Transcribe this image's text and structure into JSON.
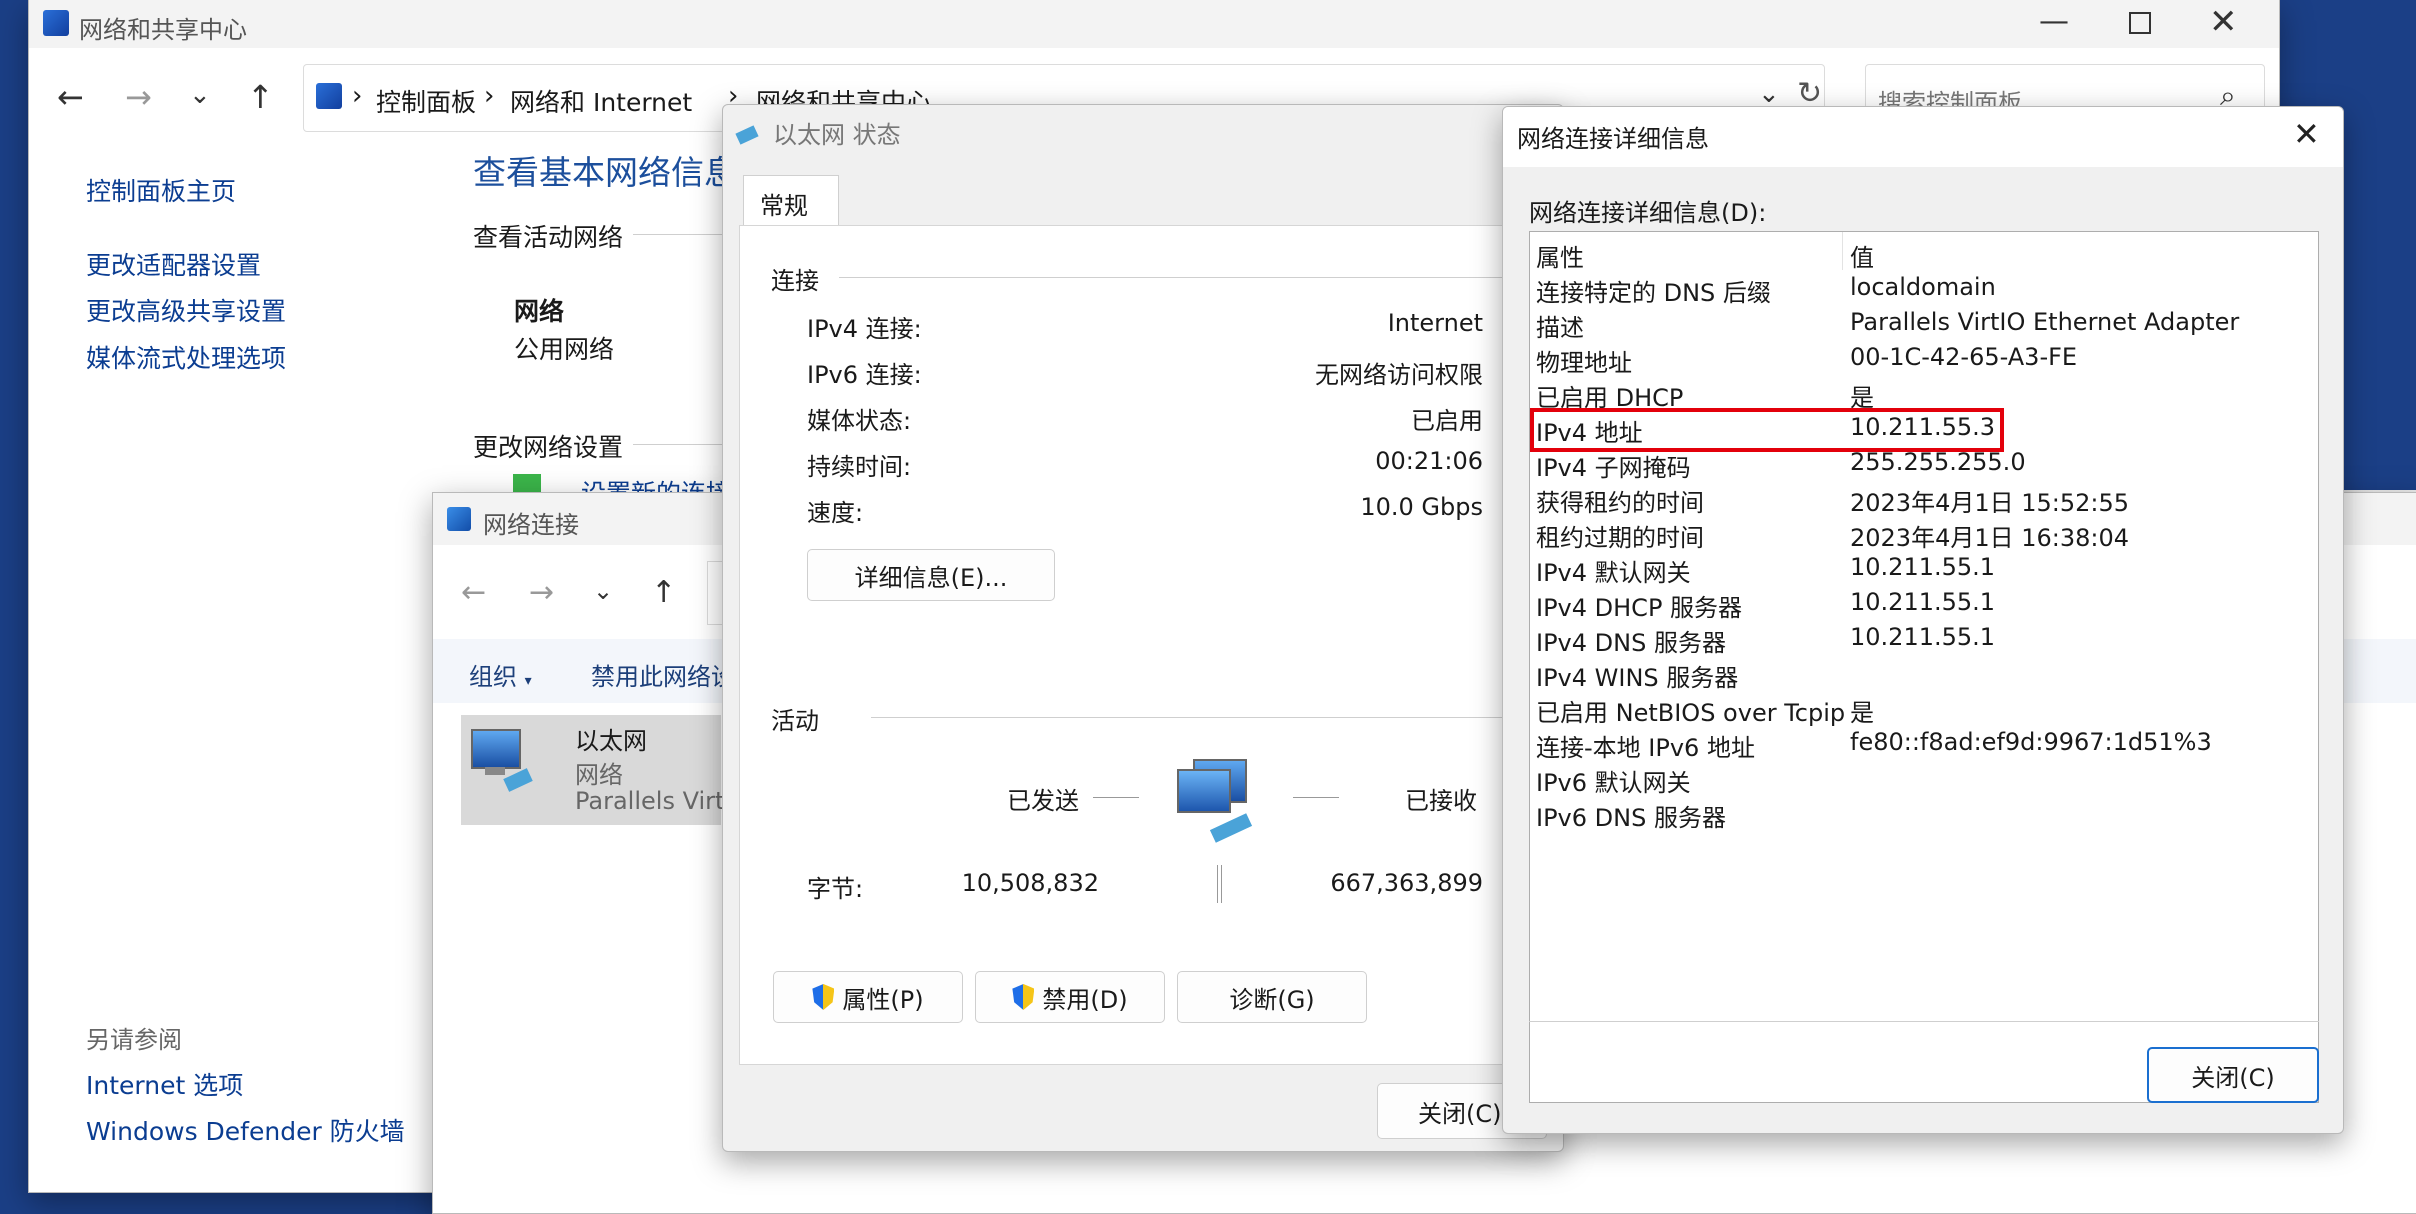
{
  "main": {
    "title": "网络和共享中心",
    "breadcrumb": {
      "root": "控制面板",
      "section": "网络和 Internet",
      "current": "网络和共享中心"
    },
    "search_placeholder": "搜索控制面板",
    "sidebar": {
      "home": "控制面板主页",
      "items": [
        "更改适配器设置",
        "更改高级共享设置",
        "媒体流式处理选项"
      ],
      "see_also_title": "另请参阅",
      "see_also": [
        "Internet 选项",
        "Windows Defender 防火墙"
      ]
    },
    "heading": "查看基本网络信息",
    "active_networks_label": "查看活动网络",
    "network_name": "网络",
    "network_type": "公用网络",
    "change_settings_label": "更改网络设置",
    "setup_connection": "设置新的连接"
  },
  "netconn": {
    "title": "网络连接",
    "toolbar": {
      "organize": "组织",
      "disable": "禁用此网络设"
    },
    "adapter": {
      "name": "以太网",
      "status": "网络",
      "device": "Parallels Virtl"
    }
  },
  "status": {
    "title": "以太网 状态",
    "tab": "常规",
    "connection_label": "连接",
    "rows": [
      {
        "label": "IPv4 连接:",
        "value": "Internet"
      },
      {
        "label": "IPv6 连接:",
        "value": "无网络访问权限"
      },
      {
        "label": "媒体状态:",
        "value": "已启用"
      },
      {
        "label": "持续时间:",
        "value": "00:21:06"
      },
      {
        "label": "速度:",
        "value": "10.0 Gbps"
      }
    ],
    "details_button": "详细信息(E)...",
    "activity_label": "活动",
    "sent_label": "已发送",
    "received_label": "已接收",
    "bytes_label": "字节:",
    "bytes_sent": "10,508,832",
    "bytes_received": "667,363,899",
    "properties_button": "属性(P)",
    "disable_button": "禁用(D)",
    "diagnose_button": "诊断(G)",
    "close_button": "关闭(C)"
  },
  "details": {
    "title": "网络连接详细信息",
    "list_label": "网络连接详细信息(D):",
    "col_property": "属性",
    "col_value": "值",
    "rows": [
      {
        "property": "连接特定的 DNS 后缀",
        "value": "localdomain"
      },
      {
        "property": "描述",
        "value": "Parallels VirtIO Ethernet Adapter"
      },
      {
        "property": "物理地址",
        "value": "00-1C-42-65-A3-FE"
      },
      {
        "property": "已启用 DHCP",
        "value": "是"
      },
      {
        "property": "IPv4 地址",
        "value": "10.211.55.3"
      },
      {
        "property": "IPv4 子网掩码",
        "value": "255.255.255.0"
      },
      {
        "property": "获得租约的时间",
        "value": "2023年4月1日 15:52:55"
      },
      {
        "property": "租约过期的时间",
        "value": "2023年4月1日 16:38:04"
      },
      {
        "property": "IPv4 默认网关",
        "value": "10.211.55.1"
      },
      {
        "property": "IPv4 DHCP 服务器",
        "value": "10.211.55.1"
      },
      {
        "property": "IPv4 DNS 服务器",
        "value": "10.211.55.1"
      },
      {
        "property": "IPv4 WINS 服务器",
        "value": ""
      },
      {
        "property": "已启用 NetBIOS over Tcpip",
        "value": "是"
      },
      {
        "property": "连接-本地 IPv6 地址",
        "value": "fe80::f8ad:ef9d:9967:1d51%3"
      },
      {
        "property": "IPv6 默认网关",
        "value": ""
      },
      {
        "property": "IPv6 DNS 服务器",
        "value": ""
      }
    ],
    "close_button": "关闭(C)",
    "highlight_color": "#e3000b"
  }
}
